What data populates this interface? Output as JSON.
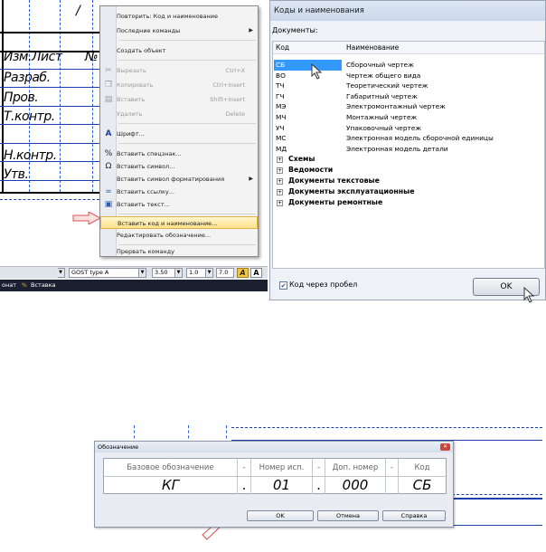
{
  "drawing": {
    "title_block_labels": [
      "Изм.",
      "Лист",
      "№",
      "Разраб.",
      "Пров.",
      "Т.контр.",
      "Н.контр.",
      "Утв."
    ],
    "slash": "/"
  },
  "context_menu": {
    "items": [
      {
        "label": "Повторить: Код и наименование",
        "shortcut": "",
        "icon": "",
        "disabled": false,
        "submenu": false
      },
      {
        "label": "Последние команды",
        "shortcut": "",
        "icon": "",
        "disabled": false,
        "submenu": true
      },
      {
        "label": "Создать объект",
        "shortcut": "",
        "icon": "",
        "disabled": false,
        "submenu": false
      },
      {
        "label": "Вырезать",
        "shortcut": "Ctrl+X",
        "icon": "scissors-icon",
        "disabled": true,
        "submenu": false
      },
      {
        "label": "Копировать",
        "shortcut": "Ctrl+Insert",
        "icon": "copy-icon",
        "disabled": true,
        "submenu": false
      },
      {
        "label": "Вставить",
        "shortcut": "Shift+Insert",
        "icon": "paste-icon",
        "disabled": true,
        "submenu": false
      },
      {
        "label": "Удалить",
        "shortcut": "Delete",
        "icon": "",
        "disabled": true,
        "submenu": false
      },
      {
        "label": "Шрифт...",
        "shortcut": "",
        "icon": "font-icon",
        "disabled": false,
        "submenu": false
      },
      {
        "label": "Вставить спецзнак...",
        "shortcut": "",
        "icon": "special-char-icon",
        "disabled": false,
        "submenu": false
      },
      {
        "label": "Вставить символ...",
        "shortcut": "",
        "icon": "omega-icon",
        "disabled": false,
        "submenu": false
      },
      {
        "label": "Вставить символ форматирования",
        "shortcut": "",
        "icon": "",
        "disabled": false,
        "submenu": true
      },
      {
        "label": "Вставить ссылку...",
        "shortcut": "",
        "icon": "link-icon",
        "disabled": false,
        "submenu": false
      },
      {
        "label": "Вставить текст...",
        "shortcut": "",
        "icon": "text-icon",
        "disabled": false,
        "submenu": false
      },
      {
        "label": "Вставить код и наименование...",
        "shortcut": "",
        "icon": "",
        "disabled": false,
        "submenu": false,
        "highlighted": true
      },
      {
        "label": "Редактировать обозначение...",
        "shortcut": "",
        "icon": "",
        "disabled": false,
        "submenu": false
      },
      {
        "label": "Прервать команду",
        "shortcut": "",
        "icon": "",
        "disabled": false,
        "submenu": false
      }
    ]
  },
  "toolbar": {
    "font": "GOST type A",
    "size": "3.50",
    "scale": "1.0",
    "spacing": "7.0",
    "bold_label": "A",
    "tabs": [
      "онат",
      "Вставка"
    ]
  },
  "codes_dialog": {
    "title": "Коды и наименования",
    "documents_label": "Документы:",
    "col_code": "Код",
    "col_name": "Наименование",
    "rows": [
      {
        "code": "СБ",
        "name": "Сборочный чертеж"
      },
      {
        "code": "ВО",
        "name": "Чертеж общего вида"
      },
      {
        "code": "ТЧ",
        "name": "Теоретический чертеж"
      },
      {
        "code": "ГЧ",
        "name": "Габаритный чертеж"
      },
      {
        "code": "МЭ",
        "name": "Электромонтажный чертеж"
      },
      {
        "code": "МЧ",
        "name": "Монтажный чертеж"
      },
      {
        "code": "УЧ",
        "name": "Упаковочный чертеж"
      },
      {
        "code": "МС",
        "name": "Электронная модель сборочной единицы"
      },
      {
        "code": "МД",
        "name": "Электронная модель детали"
      }
    ],
    "groups": [
      "Схемы",
      "Ведомости",
      "Документы текстовые",
      "Документы эксплуатационные",
      "Документы ремонтные"
    ],
    "checkbox_label": "Код через пробел",
    "checkbox_checked": true,
    "ok_label": "OK"
  },
  "designation_dialog": {
    "title": "Обозначение",
    "headers": [
      "Базовое обозначение",
      "-",
      "Номер исп.",
      "-",
      "Доп. номер",
      "-",
      "Код"
    ],
    "values": [
      "КГ",
      ".",
      "01",
      ".",
      "000",
      "",
      "СБ"
    ],
    "ok_label": "OK",
    "cancel_label": "Отмена",
    "help_label": "Справка"
  }
}
